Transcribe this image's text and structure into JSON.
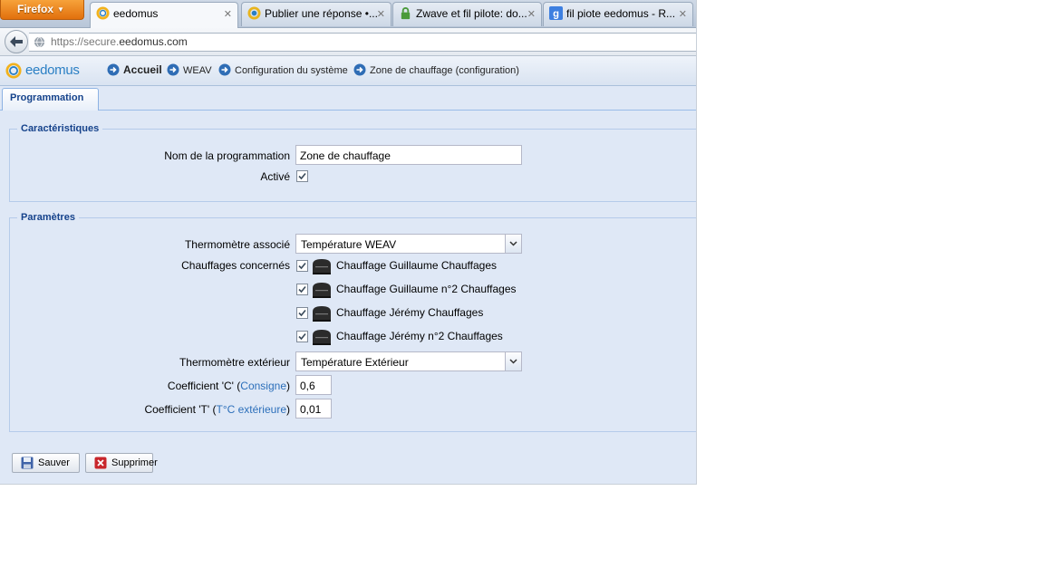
{
  "browser": {
    "menu_button": "Firefox",
    "tabs": [
      {
        "title": "eedomus",
        "active": true
      },
      {
        "title": "Publier une réponse •...",
        "active": false
      },
      {
        "title": "Zwave et fil pilote: do...",
        "active": false
      },
      {
        "title": "fil piote eedomus - R...",
        "active": false
      }
    ],
    "url_prefix": "https://secure.",
    "url_domain": "eedomus.com"
  },
  "app": {
    "logo_text": "eedomus",
    "breadcrumb": [
      {
        "label": "Accueil"
      },
      {
        "label": "WEAV"
      },
      {
        "label": "Configuration du système"
      },
      {
        "label": "Zone de chauffage (configuration)"
      }
    ],
    "page_tab": "Programmation"
  },
  "form": {
    "caracteristiques": {
      "legend": "Caractéristiques",
      "name_label": "Nom de la programmation",
      "name_value": "Zone de chauffage",
      "active_label": "Activé",
      "active_checked": true
    },
    "parametres": {
      "legend": "Paramètres",
      "thermometre_label": "Thermomètre associé",
      "thermometre_value": "Température WEAV",
      "chauffages_label": "Chauffages concernés",
      "chauffages": [
        {
          "label": "Chauffage Guillaume Chauffages",
          "checked": true
        },
        {
          "label": "Chauffage Guillaume n°2 Chauffages",
          "checked": true
        },
        {
          "label": "Chauffage Jérémy Chauffages",
          "checked": true
        },
        {
          "label": "Chauffage Jérémy n°2 Chauffages",
          "checked": true
        }
      ],
      "ext_thermometre_label": "Thermomètre extérieur",
      "ext_thermometre_value": "Température Extérieur",
      "coef_c_label": "Coefficient 'C' (",
      "coef_c_link": "Consigne",
      "coef_c_close": ")",
      "coef_c_value": "0,6",
      "coef_t_label": "Coefficient 'T' (",
      "coef_t_link": "T°C extérieure",
      "coef_t_close": ")",
      "coef_t_value": "0,01"
    }
  },
  "actions": {
    "save": "Sauver",
    "delete": "Supprimer"
  },
  "colors": {
    "accent": "#15428b",
    "link": "#2c6fba",
    "panel_bg": "#dfe8f6",
    "logo": "#2a7fc4",
    "firefox": "#e2700d"
  }
}
